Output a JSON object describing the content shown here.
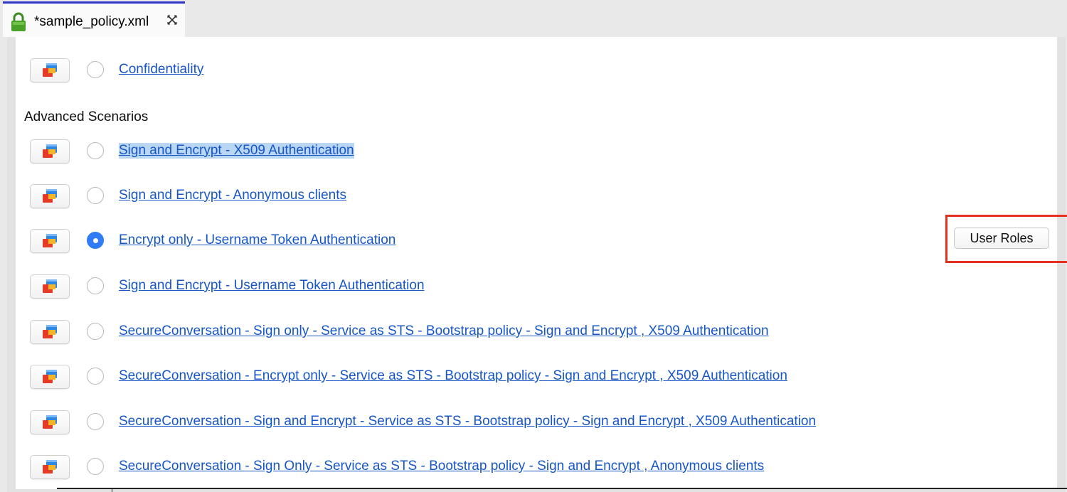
{
  "tab": {
    "title": "*sample_policy.xml",
    "icon": "lock-icon",
    "close_icon": "close-icon"
  },
  "colors": {
    "link": "#1756c8",
    "radio_selected": "#2f7cf6",
    "tab_accent": "#2f35c9",
    "highlight": "#e8301e"
  },
  "policies": [
    {
      "label": "Confidentiality",
      "selected": false
    },
    {
      "label": "Sign and Encrypt - X509 Authentication",
      "selected": false
    },
    {
      "label": "Sign and Encrypt - Anonymous clients",
      "selected": false
    },
    {
      "label": "Encrypt only - Username Token Authentication",
      "selected": true
    },
    {
      "label": "Sign and Encrypt - Username Token Authentication",
      "selected": false
    },
    {
      "label": "SecureConversation - Sign only - Service as STS - Bootstrap policy - Sign and Encrypt , X509 Authentication",
      "selected": false
    },
    {
      "label": "SecureConversation - Encrypt only - Service as STS - Bootstrap policy - Sign and Encrypt , X509 Authentication",
      "selected": false
    },
    {
      "label": "SecureConversation - Sign and Encrypt - Service as STS - Bootstrap policy - Sign and Encrypt , X509 Authentication",
      "selected": false
    },
    {
      "label": "SecureConversation - Sign Only - Service as STS - Bootstrap policy - Sign and Encrypt , Anonymous clients",
      "selected": false
    }
  ],
  "section_title": "Advanced Scenarios",
  "user_roles_label": "User Roles"
}
